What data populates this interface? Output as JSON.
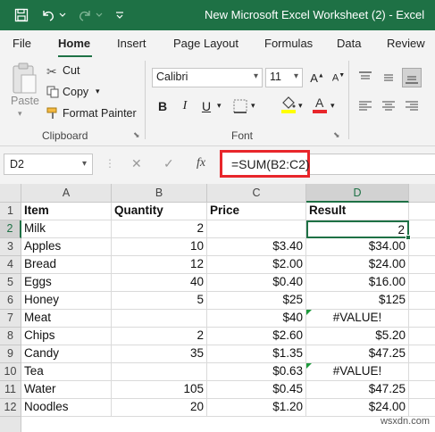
{
  "window": {
    "title": "New Microsoft Excel Worksheet (2)  -  Excel",
    "titlebar_color": "#1e7145"
  },
  "ribbon_tabs": [
    {
      "label": "File",
      "active": false
    },
    {
      "label": "Home",
      "active": true
    },
    {
      "label": "Insert",
      "active": false
    },
    {
      "label": "Page Layout",
      "active": false
    },
    {
      "label": "Formulas",
      "active": false
    },
    {
      "label": "Data",
      "active": false
    },
    {
      "label": "Review",
      "active": false
    }
  ],
  "clipboard": {
    "paste_label": "Paste",
    "cut_label": "Cut",
    "copy_label": "Copy",
    "format_painter_label": "Format Painter",
    "group_label": "Clipboard"
  },
  "font": {
    "font_name": "Calibri",
    "font_size": "11",
    "group_label": "Font",
    "bold": "B",
    "italic": "I",
    "underline": "U",
    "font_color_letter": "A"
  },
  "formula_bar": {
    "name_box": "D2",
    "cancel_symbol": "✕",
    "enter_symbol": "✓",
    "fx_label": "fx",
    "formula": "=SUM(B2:C2)",
    "highlight_color": "#e8262b"
  },
  "grid": {
    "columns": [
      "A",
      "B",
      "C",
      "D"
    ],
    "selected_column": "D",
    "selected_row": "2",
    "active_cell": "D2",
    "rows": [
      {
        "num": "1",
        "a": "Item",
        "b": "Quantity",
        "c": "Price",
        "d": "Result"
      },
      {
        "num": "2",
        "a": "Milk",
        "b": "2",
        "c": "",
        "d": "2"
      },
      {
        "num": "3",
        "a": "Apples",
        "b": "10",
        "c": "$3.40",
        "d": "$34.00"
      },
      {
        "num": "4",
        "a": "Bread",
        "b": "12",
        "c": "$2.00",
        "d": "$24.00"
      },
      {
        "num": "5",
        "a": "Eggs",
        "b": "40",
        "c": "$0.40",
        "d": "$16.00"
      },
      {
        "num": "6",
        "a": "Honey",
        "b": "5",
        "c": "$25",
        "d": "$125"
      },
      {
        "num": "7",
        "a": "Meat",
        "b": "",
        "c": "$40",
        "d": "#VALUE!"
      },
      {
        "num": "8",
        "a": "Chips",
        "b": "2",
        "c": "$2.60",
        "d": "$5.20"
      },
      {
        "num": "9",
        "a": "Candy",
        "b": "35",
        "c": "$1.35",
        "d": "$47.25"
      },
      {
        "num": "10",
        "a": "Tea",
        "b": "",
        "c": "$0.63",
        "d": "#VALUE!"
      },
      {
        "num": "11",
        "a": "Water",
        "b": "105",
        "c": "$0.45",
        "d": "$47.25"
      },
      {
        "num": "12",
        "a": "Noodles",
        "b": "20",
        "c": "$1.20",
        "d": "$24.00"
      }
    ]
  },
  "watermark": "wsxdn.com"
}
